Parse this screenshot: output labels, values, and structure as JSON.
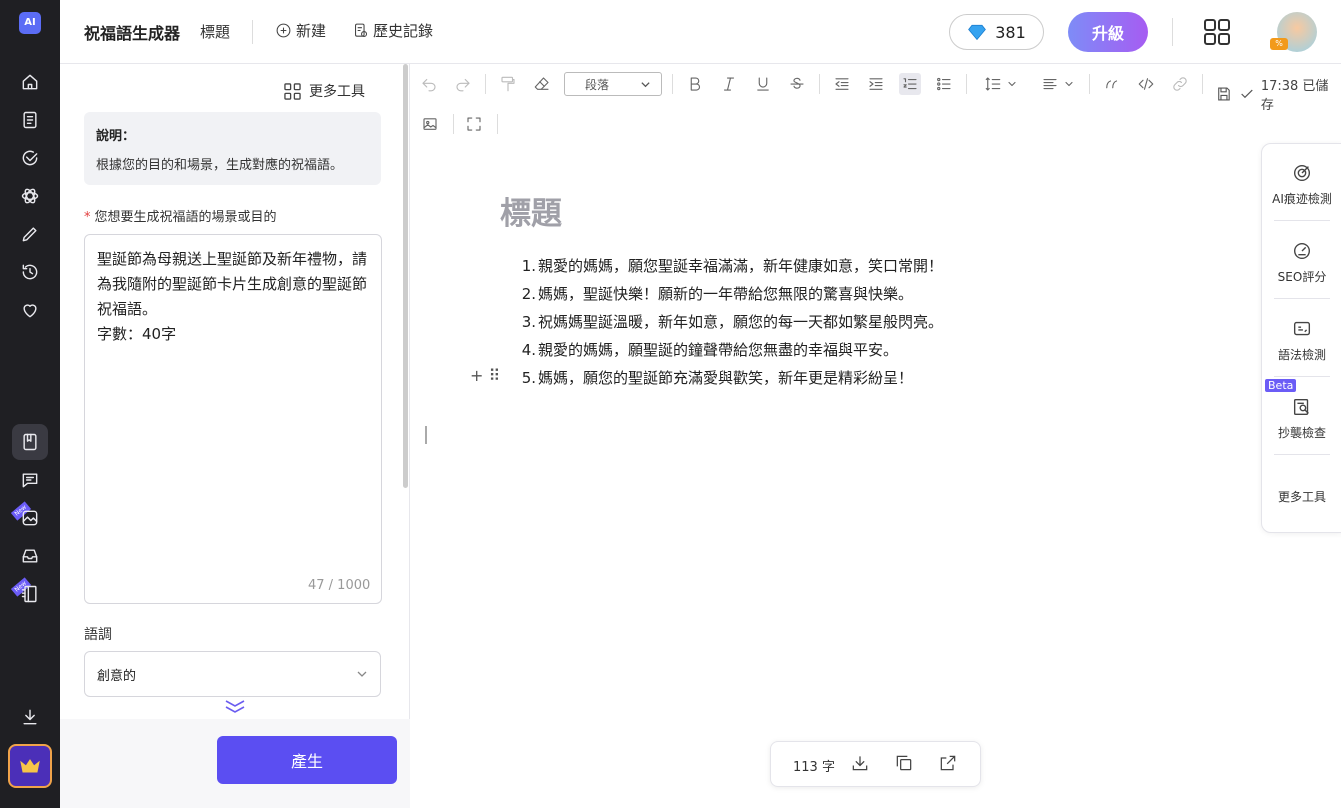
{
  "rail": {
    "logo_text": "AI",
    "new_tag": "New"
  },
  "header": {
    "app_title": "祝福語生成器",
    "doc_tab": "標題",
    "new_button": "新建",
    "history_button": "歷史記錄",
    "gems_count": "381",
    "upgrade_button": "升級",
    "avatar_badge": "%"
  },
  "panel": {
    "more_tools": "更多工具",
    "description_title": "說明：",
    "description_text": "根據您的目的和場景，生成對應的祝福語。",
    "required_mark": "*",
    "prompt_label": "您想要生成祝福語的場景或目的",
    "prompt_value": "聖誕節為母親送上聖誕節及新年禮物，請為我隨附的聖誕節卡片生成創意的聖誕節祝福語。\n字數：40字",
    "char_counter": "47 / 1000",
    "tone_label": "語調",
    "tone_value": "創意的",
    "generate_button": "產生"
  },
  "toolbar": {
    "paragraph_select": "段落",
    "saved_status": "17:38 已儲存"
  },
  "document": {
    "title": "標題",
    "items": [
      "親愛的媽媽，願您聖誕幸福滿滿，新年健康如意，笑口常開！",
      "媽媽，聖誕快樂！願新的一年帶給您無限的驚喜與快樂。",
      "祝媽媽聖誕溫暖，新年如意，願您的每一天都如繁星般閃亮。",
      "親愛的媽媽，願聖誕的鐘聲帶給您無盡的幸福與平安。",
      "媽媽，願您的聖誕節充滿愛與歡笑，新年更是精彩紛呈！"
    ],
    "numbers": [
      "1.",
      "2.",
      "3.",
      "4.",
      "5."
    ],
    "row_handle": "+ ⠿"
  },
  "right_tools": {
    "ai_detect": "AI痕迹檢測",
    "seo": "SEO評分",
    "grammar": "語法檢測",
    "beta_tag": "Beta",
    "plagiarism": "抄襲檢查",
    "more": "更多工具"
  },
  "wordbar": {
    "word_count": "113 字"
  }
}
